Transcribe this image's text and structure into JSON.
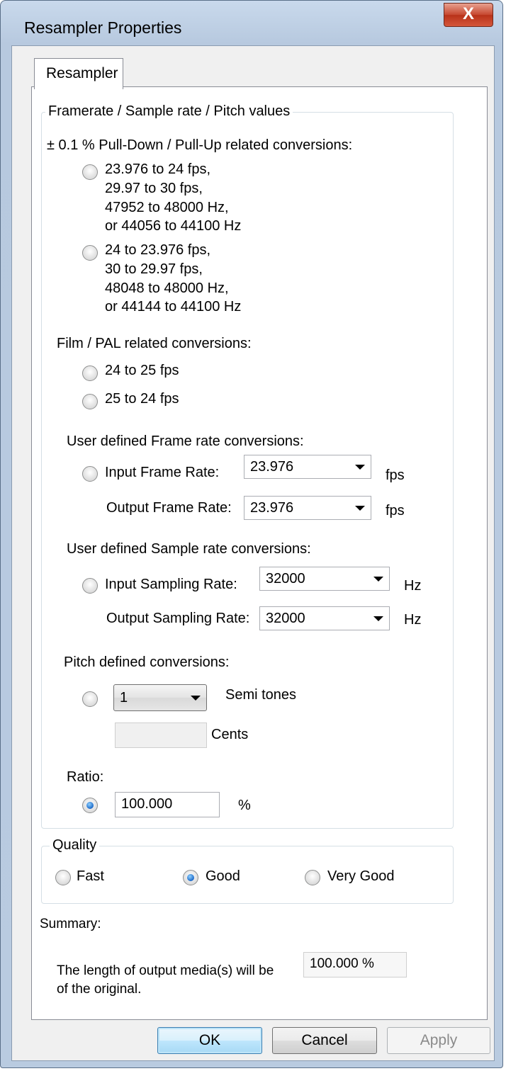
{
  "window": {
    "title": "Resampler Properties",
    "close_glyph": "X"
  },
  "tabs": [
    {
      "label": "Resampler"
    }
  ],
  "rates_group": {
    "legend": "Framerate / Sample rate / Pitch values",
    "pulldown": {
      "heading": "± 0.1 % Pull-Down / Pull-Up related conversions:",
      "option1": [
        "23.976 to 24 fps,",
        "29.97 to 30 fps,",
        "47952 to 48000 Hz,",
        "or 44056 to 44100 Hz"
      ],
      "option2": [
        "24 to 23.976 fps,",
        "30 to 29.97 fps,",
        "48048 to 48000 Hz,",
        "or 44144 to 44100 Hz"
      ]
    },
    "film_pal": {
      "heading": "Film / PAL related conversions:",
      "option1": "24 to 25 fps",
      "option2": "25 to 24 fps"
    },
    "frame_rate": {
      "heading": "User defined Frame rate conversions:",
      "input_label": "Input Frame Rate:",
      "input_value": "23.976",
      "output_label": "Output Frame Rate:",
      "output_value": "23.976",
      "unit": "fps"
    },
    "sample_rate": {
      "heading": "User defined Sample rate conversions:",
      "input_label": "Input Sampling Rate:",
      "input_value": "32000",
      "output_label": "Output Sampling Rate:",
      "output_value": "32000",
      "unit": "Hz"
    },
    "pitch": {
      "heading": "Pitch defined conversions:",
      "semitones_value": "1",
      "semitones_label": "Semi tones",
      "cents_value": "",
      "cents_label": "Cents"
    },
    "ratio": {
      "heading": "Ratio:",
      "value": "100.000",
      "unit": "%",
      "selected": true
    }
  },
  "quality": {
    "legend": "Quality",
    "options": [
      "Fast",
      "Good",
      "Very Good"
    ],
    "selected": "Good"
  },
  "summary": {
    "label": "Summary:",
    "line1": "The length of output media(s) will be",
    "value": "100.000 %",
    "line2": "of the original."
  },
  "buttons": {
    "ok": "OK",
    "cancel": "Cancel",
    "apply": "Apply"
  }
}
